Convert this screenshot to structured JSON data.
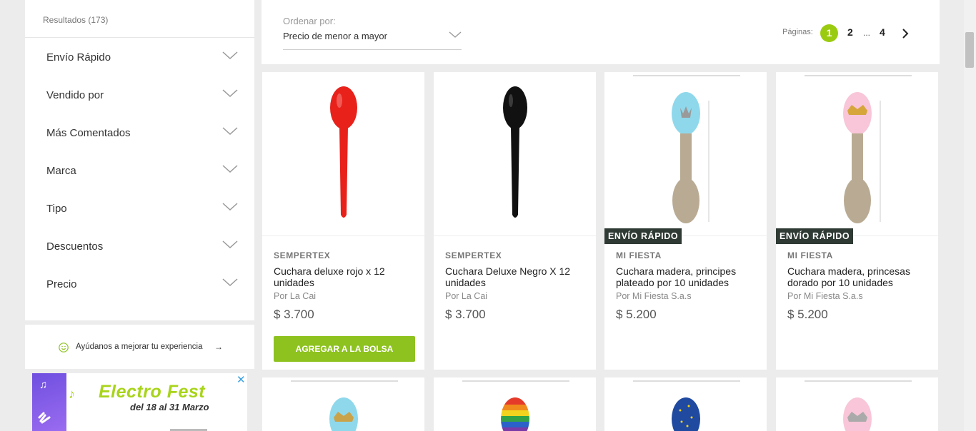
{
  "sidebar": {
    "results_label": "Resultados (173)",
    "filters": [
      {
        "label": "Envío Rápido"
      },
      {
        "label": "Vendido por"
      },
      {
        "label": "Más Comentados"
      },
      {
        "label": "Marca"
      },
      {
        "label": "Tipo"
      },
      {
        "label": "Descuentos"
      },
      {
        "label": "Precio"
      }
    ]
  },
  "feedback": {
    "text": "Ayúdanos a mejorar tu experiencia",
    "arrow": "→"
  },
  "banner": {
    "title": "Electro Fest",
    "subtitle": "del 18 al 31 Marzo",
    "close": "✕"
  },
  "sort": {
    "caption": "Ordenar por:",
    "value": "Precio de menor a mayor"
  },
  "pagination": {
    "caption": "Páginas:",
    "current": "1",
    "pages": [
      "2",
      "...",
      "4"
    ]
  },
  "products": [
    {
      "brand": "SEMPERTEX",
      "name": "Cuchara deluxe rojo x 12 unidades",
      "seller": "Por La Cai",
      "price": "$ 3.700",
      "button": "AGREGAR A LA BOLSA",
      "badge": ""
    },
    {
      "brand": "SEMPERTEX",
      "name": "Cuchara Deluxe Negro X 12 unidades",
      "seller": "Por La Cai",
      "price": "$ 3.700",
      "badge": ""
    },
    {
      "brand": "MI FIESTA",
      "name": "Cuchara madera, principes plateado por 10 unidades",
      "seller": "Por Mi Fiesta S.a.s",
      "price": "$ 5.200",
      "badge": "ENVÍO RÁPIDO"
    },
    {
      "brand": "MI FIESTA",
      "name": "Cuchara madera, princesas dorado por 10 unidades",
      "seller": "Por Mi Fiesta S.a.s",
      "price": "$ 5.200",
      "badge": "ENVÍO RÁPIDO"
    }
  ]
}
